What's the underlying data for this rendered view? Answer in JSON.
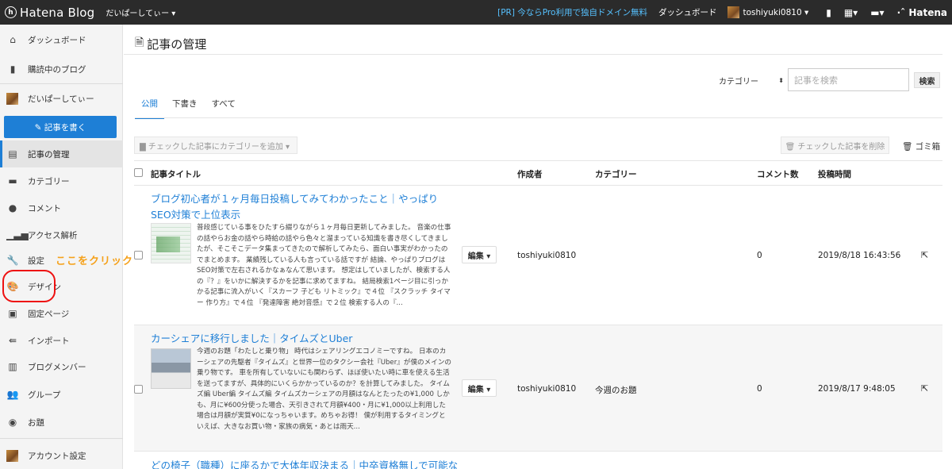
{
  "topbar": {
    "brand_mark": "h",
    "brand_name": "Hatena Blog",
    "blog_name": "だいぱーしてぃー ▾",
    "pr_link": "[PR] 今ならPro利用で独自ドメイン無料",
    "dashboard_link": "ダッシュボード",
    "user_name": "toshiyuki0810 ▾",
    "hatena_logo": "·ˆ Hatena"
  },
  "sidebar": {
    "items": [
      {
        "label": "ダッシュボード"
      },
      {
        "label": "購読中のブログ"
      },
      {
        "label": "だいぱーしてぃー"
      },
      {
        "label": "記事の管理"
      },
      {
        "label": "カテゴリー"
      },
      {
        "label": "コメント"
      },
      {
        "label": "アクセス解析"
      },
      {
        "label": "設定"
      },
      {
        "label": "デザイン"
      },
      {
        "label": "固定ページ"
      },
      {
        "label": "インポート"
      },
      {
        "label": "ブログメンバー"
      },
      {
        "label": "グループ"
      },
      {
        "label": "お題"
      },
      {
        "label": "アカウント設定"
      }
    ],
    "write_button": "✎ 記事を書く"
  },
  "annotation": "ここをクリック！",
  "main": {
    "title": "記事の管理",
    "category_select": "カテゴリー",
    "search_placeholder": "記事を検索",
    "search_button": "検索",
    "tabs": [
      {
        "label": "公開"
      },
      {
        "label": "下書き"
      },
      {
        "label": "すべて"
      }
    ],
    "bulk_category_button": "▇ チェックした記事にカテゴリーを追加 ▾",
    "bulk_delete_button": "🗑 チェックした記事を削除",
    "trash_link": "🗑 ゴミ箱",
    "columns": {
      "title": "記事タイトル",
      "author": "作成者",
      "category": "カテゴリー",
      "comments": "コメント数",
      "posted": "投稿時間"
    },
    "edit_label": "編集 ▾",
    "rows": [
      {
        "title": "ブログ初心者が１ヶ月毎日投稿してみてわかったこと｜やっぱりSEO対策で上位表示",
        "excerpt": "普段感じている事をひたすら綴りながら１ヶ月毎日更新してみました。 音楽の仕事の話やらお金の話やら時給の話やら色々と溜まっている知識を書き尽くしてきましたが、そこそこデータ集まってきたので解析してみたら、面白い事実がわかったのでまとめます。 業績残している人も言っている話ですが 結論、やっぱりブログはSEO対策で左右されるかなぁなんて思います。 想定はしていましたが、検索する人の『？』をいかに解決するかを記事に求めてますね。 結局検索1ページ目に引っかかる記事に流入がいく『スカーフ 子ども リトミック』で４位 『スクラッチ タイマー 作り方』で４位 『発達障害 絶対音感』で２位 検索する人の『...",
        "author": "toshiyuki0810",
        "category": "",
        "comments": "0",
        "posted": "2019/8/18 16:43:56"
      },
      {
        "title": "カーシェアに移行しました｜タイムズとUber",
        "excerpt": "今週のお題「わたしと乗り物」 時代はシェアリングエコノミーですね。 日本のカーシェアの先駆者『タイムズ』と世界一位のタクシー会社『Uber』が僕のメインの乗り物です。 車を所有していないにも関わらず、ほぼ使いたい時に車を使える生活を送ってますが、具体的にいくらかかっているのか？を計算してみました。 タイムズ編 Uber編 タイムズ編 タイムズカーシェアの月額はなんとたったの¥1,000 しかも、月に¥600分使った場合、天引きされて月額¥400・月に¥1,000以上利用した場合は月額が実質¥0になっちゃいます。めちゃお得！ 僕が利用するタイミングといえば、大きなお買い物・家族の病気・あとは雨天...",
        "author": "toshiyuki0810",
        "category": "今週のお題",
        "comments": "0",
        "posted": "2019/8/17 9:48:05"
      },
      {
        "title": "どの椅子（職種）に座るかで大体年収決まる｜中卒資格無しで可能な"
      }
    ]
  }
}
